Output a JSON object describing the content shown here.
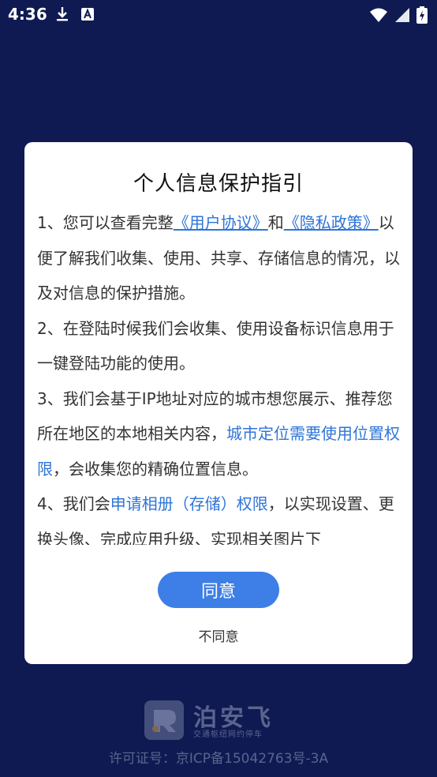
{
  "status": {
    "time": "4:36"
  },
  "dialog": {
    "title": "个人信息保护指引",
    "p1_a": "1、您可以查看完整",
    "p1_link1": "《用户协议》",
    "p1_b": "和",
    "p1_link2": "《隐私政策》",
    "p1_c": "以便了解我们收集、使用、共享、存储信息的情况，以及对信息的保护措施。",
    "p2": "2、在登陆时候我们会收集、使用设备标识信息用于一键登陆功能的使用。",
    "p3_a": "3、我们会基于IP地址对应的城市想您展示、推荐您所在地区的本地相关内容，",
    "p3_link": "城市定位需要使用位置权限",
    "p3_b": "，会收集您的精确位置信息。",
    "p4_a": "4、我们会",
    "p4_link": "申请相册（存储）权限",
    "p4_b": "，以实现设置、更换头像、完成应用升级、实现相关图片下",
    "agree_label": "同意",
    "disagree_label": "不同意"
  },
  "footer": {
    "logo_text": "泊安飞",
    "slogan": "交通枢纽网约停车",
    "license": "许可证号：京ICP备15042763号-3A"
  },
  "colors": {
    "background": "#0f1a52",
    "accent": "#3d7fe6",
    "link": "#2e74d9"
  }
}
